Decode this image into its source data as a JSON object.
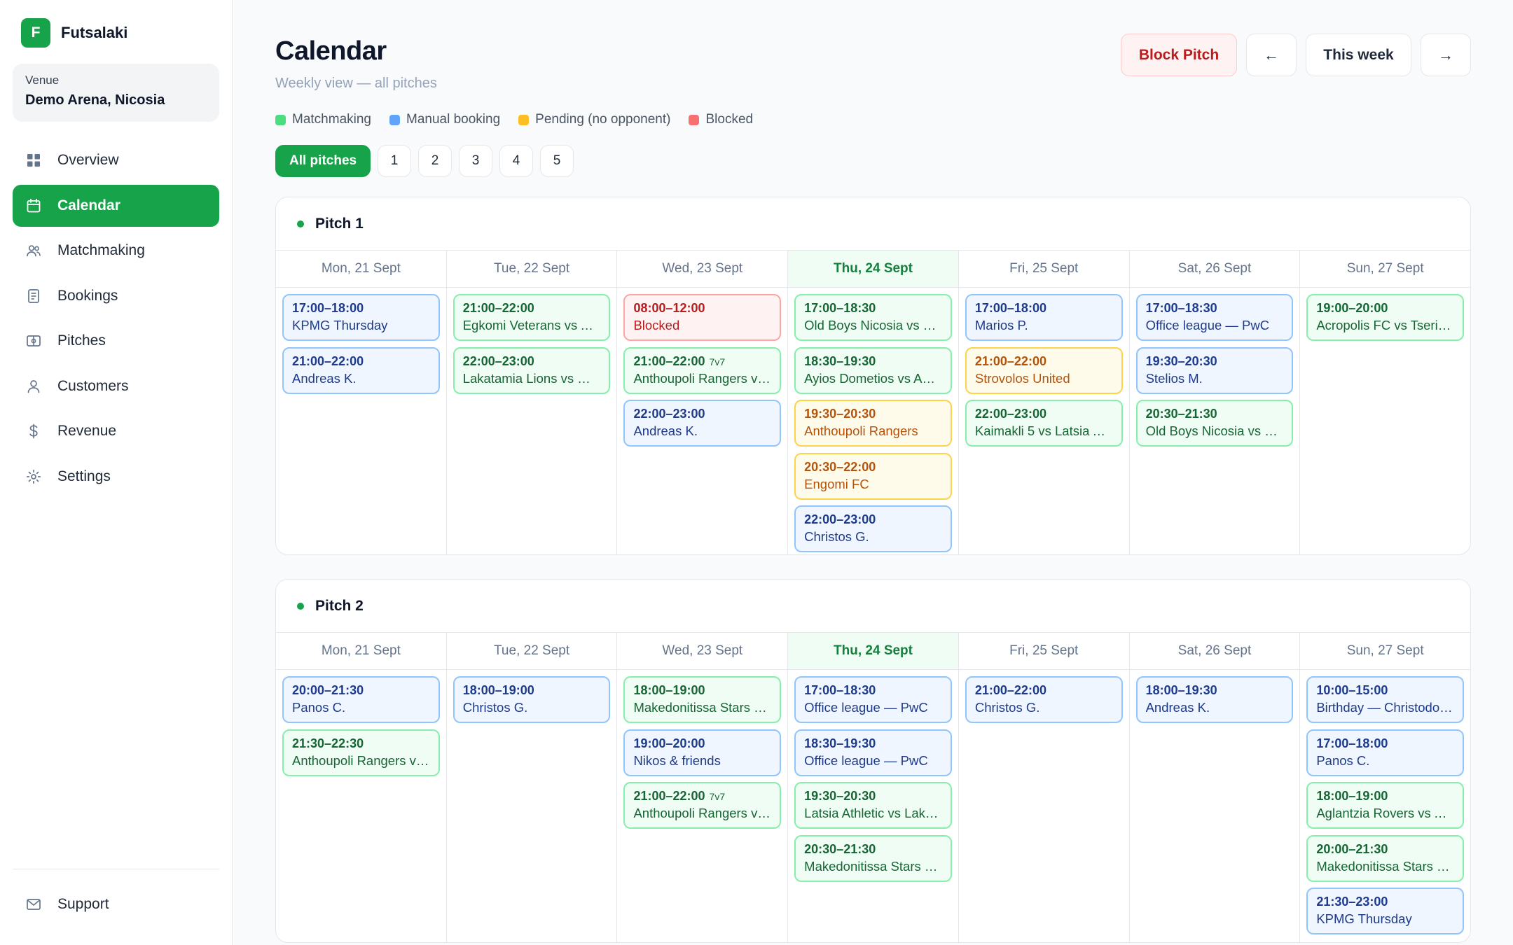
{
  "brand": {
    "logo_letter": "F",
    "name": "Futsalaki"
  },
  "venue": {
    "label": "Venue",
    "name": "Demo Arena, Nicosia"
  },
  "nav": [
    {
      "id": "overview",
      "label": "Overview",
      "icon": "grid-icon",
      "active": false
    },
    {
      "id": "calendar",
      "label": "Calendar",
      "icon": "calendar-icon",
      "active": true
    },
    {
      "id": "matchmaking",
      "label": "Matchmaking",
      "icon": "users-icon",
      "active": false
    },
    {
      "id": "bookings",
      "label": "Bookings",
      "icon": "document-icon",
      "active": false
    },
    {
      "id": "pitches",
      "label": "Pitches",
      "icon": "pitch-icon",
      "active": false
    },
    {
      "id": "customers",
      "label": "Customers",
      "icon": "user-icon",
      "active": false
    },
    {
      "id": "revenue",
      "label": "Revenue",
      "icon": "dollar-icon",
      "active": false
    },
    {
      "id": "settings",
      "label": "Settings",
      "icon": "gear-icon",
      "active": false
    }
  ],
  "support": {
    "label": "Support",
    "icon": "mail-icon"
  },
  "header": {
    "title": "Calendar",
    "subtitle": "Weekly view — all pitches"
  },
  "actions": {
    "block_label": "Block Pitch",
    "prev_label": "←",
    "week_label": "This week",
    "next_label": "→"
  },
  "legend": [
    {
      "label": "Matchmaking",
      "color": "#4ade80"
    },
    {
      "label": "Manual booking",
      "color": "#60a5fa"
    },
    {
      "label": "Pending (no opponent)",
      "color": "#fbbf24"
    },
    {
      "label": "Blocked",
      "color": "#f87171"
    }
  ],
  "filters": [
    {
      "label": "All pitches",
      "active": true
    },
    {
      "label": "1",
      "active": false
    },
    {
      "label": "2",
      "active": false
    },
    {
      "label": "3",
      "active": false
    },
    {
      "label": "4",
      "active": false
    },
    {
      "label": "5",
      "active": false
    }
  ],
  "days": [
    {
      "label": "Mon, 21 Sept",
      "today": false
    },
    {
      "label": "Tue, 22 Sept",
      "today": false
    },
    {
      "label": "Wed, 23 Sept",
      "today": false
    },
    {
      "label": "Thu, 24 Sept",
      "today": true
    },
    {
      "label": "Fri, 25 Sept",
      "today": false
    },
    {
      "label": "Sat, 26 Sept",
      "today": false
    },
    {
      "label": "Sun, 27 Sept",
      "today": false
    }
  ],
  "pitches": [
    {
      "name": "Pitch 1",
      "days": [
        [
          {
            "time": "17:00–18:00",
            "title": "KPMG Thursday",
            "type": "booking"
          },
          {
            "time": "21:00–22:00",
            "title": "Andreas K.",
            "type": "booking"
          }
        ],
        [
          {
            "time": "21:00–22:00",
            "title": "Egkomi Veterans vs A…",
            "type": "matchmaking"
          },
          {
            "time": "22:00–23:00",
            "title": "Lakatamia Lions vs M…",
            "type": "matchmaking"
          }
        ],
        [
          {
            "time": "08:00–12:00",
            "title": "Blocked",
            "type": "blocked"
          },
          {
            "time": "21:00–22:00",
            "tag": "7v7",
            "title": "Anthoupoli Rangers v…",
            "type": "matchmaking"
          },
          {
            "time": "22:00–23:00",
            "title": "Andreas K.",
            "type": "booking"
          }
        ],
        [
          {
            "time": "17:00–18:30",
            "title": "Old Boys Nicosia vs S…",
            "type": "matchmaking"
          },
          {
            "time": "18:30–19:30",
            "title": "Ayios Dometios vs Agl…",
            "type": "matchmaking"
          },
          {
            "time": "19:30–20:30",
            "title": "Anthoupoli Rangers",
            "type": "pending"
          },
          {
            "time": "20:30–22:00",
            "title": "Engomi FC",
            "type": "pending"
          },
          {
            "time": "22:00–23:00",
            "title": "Christos G.",
            "type": "booking"
          }
        ],
        [
          {
            "time": "17:00–18:00",
            "title": "Marios P.",
            "type": "booking"
          },
          {
            "time": "21:00–22:00",
            "title": "Strovolos United",
            "type": "pending"
          },
          {
            "time": "22:00–23:00",
            "title": "Kaimakli 5 vs Latsia A…",
            "type": "matchmaking"
          }
        ],
        [
          {
            "time": "17:00–18:30",
            "title": "Office league — PwC",
            "type": "booking"
          },
          {
            "time": "19:30–20:30",
            "title": "Stelios M.",
            "type": "booking"
          },
          {
            "time": "20:30–21:30",
            "title": "Old Boys Nicosia vs E…",
            "type": "matchmaking"
          }
        ],
        [
          {
            "time": "19:00–20:00",
            "title": "Acropolis FC vs Tseri …",
            "type": "matchmaking"
          }
        ]
      ]
    },
    {
      "name": "Pitch 2",
      "days": [
        [
          {
            "time": "20:00–21:30",
            "title": "Panos C.",
            "type": "booking"
          },
          {
            "time": "21:30–22:30",
            "title": "Anthoupoli Rangers v…",
            "type": "matchmaking"
          }
        ],
        [
          {
            "time": "18:00–19:00",
            "title": "Christos G.",
            "type": "booking"
          }
        ],
        [
          {
            "time": "18:00–19:00",
            "title": "Makedonitissa Stars v…",
            "type": "matchmaking"
          },
          {
            "time": "19:00–20:00",
            "title": "Nikos & friends",
            "type": "booking"
          },
          {
            "time": "21:00–22:00",
            "tag": "7v7",
            "title": "Anthoupoli Rangers v…",
            "type": "matchmaking"
          }
        ],
        [
          {
            "time": "17:00–18:30",
            "title": "Office league — PwC",
            "type": "booking"
          },
          {
            "time": "18:30–19:30",
            "title": "Office league — PwC",
            "type": "booking"
          },
          {
            "time": "19:30–20:30",
            "title": "Latsia Athletic vs Laka…",
            "type": "matchmaking"
          },
          {
            "time": "20:30–21:30",
            "title": "Makedonitissa Stars v…",
            "type": "matchmaking"
          }
        ],
        [
          {
            "time": "21:00–22:00",
            "title": "Christos G.",
            "type": "booking"
          }
        ],
        [
          {
            "time": "18:00–19:30",
            "title": "Andreas K.",
            "type": "booking"
          }
        ],
        [
          {
            "time": "10:00–15:00",
            "title": "Birthday — Christodo…",
            "type": "booking"
          },
          {
            "time": "17:00–18:00",
            "title": "Panos C.",
            "type": "booking"
          },
          {
            "time": "18:00–19:00",
            "title": "Aglantzia Rovers vs A…",
            "type": "matchmaking"
          },
          {
            "time": "20:00–21:30",
            "title": "Makedonitissa Stars v…",
            "type": "matchmaking"
          },
          {
            "time": "21:30–23:00",
            "title": "KPMG Thursday",
            "type": "booking"
          }
        ]
      ]
    }
  ]
}
